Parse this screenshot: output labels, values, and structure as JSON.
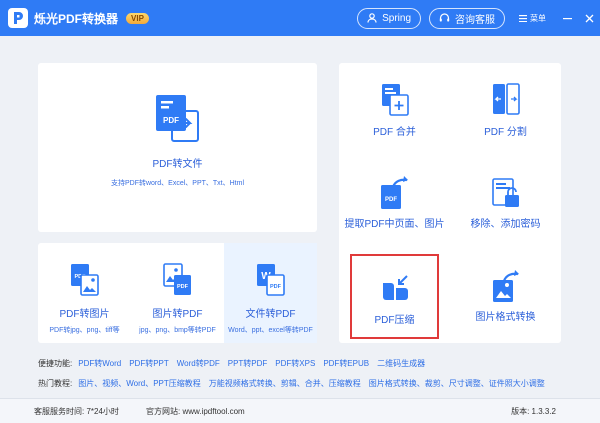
{
  "app": {
    "title": "烁光PDF转换器",
    "vip": "VIP"
  },
  "header": {
    "user": "Spring",
    "support": "咨询客服",
    "menu": "菜单"
  },
  "main_card": {
    "label": "PDF转文件",
    "sub": "支持PDF转word、Excel、PPT、Txt、Html"
  },
  "small_tiles": [
    {
      "label": "PDF转图片",
      "sub": "PDF转jpg、png、tiff等"
    },
    {
      "label": "图片转PDF",
      "sub": "jpg、png、bmp等转PDF"
    },
    {
      "label": "文件转PDF",
      "sub": "Word、ppt、excel等转PDF"
    }
  ],
  "right_tiles": [
    {
      "label": "PDF 合并"
    },
    {
      "label": "PDF 分割"
    },
    {
      "label": "提取PDF中页面、图片"
    },
    {
      "label": "移除、添加密码"
    },
    {
      "label": "PDF压缩"
    },
    {
      "label": "图片格式转换"
    }
  ],
  "quick_links": {
    "label": "便捷功能:",
    "items": [
      "PDF转Word",
      "PDF转PPT",
      "Word转PDF",
      "PPT转PDF",
      "PDF转XPS",
      "PDF转EPUB",
      "二维码生成器"
    ]
  },
  "tutorials": {
    "label": "热门教程:",
    "items": [
      "图片、视频、Word、PPT压缩教程",
      "万能视频格式转换、剪辑、合并、压缩教程",
      "图片格式转换、裁剪、尺寸调整、证件照大小调整"
    ]
  },
  "footer": {
    "service": "客服服务时间: 7*24小时",
    "website": "官方网站: www.ipdftool.com",
    "version": "版本: 1.3.3.2"
  },
  "colors": {
    "titlebar": "#2f7bf5",
    "link": "#2f6fe6",
    "highlight": "#e03a3a"
  }
}
